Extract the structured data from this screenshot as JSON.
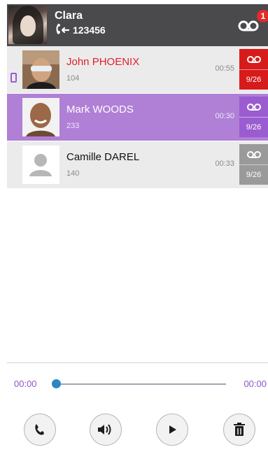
{
  "header": {
    "name": "Clara",
    "number": "123456",
    "badge_count": "1"
  },
  "calls": [
    {
      "name": "John PHOENIX",
      "ext": "104",
      "duration": "00:55",
      "date": "9/26",
      "tag_color": "#d71a1a",
      "name_color": "#e0202a",
      "selected": false
    },
    {
      "name": "Mark WOODS",
      "ext": "233",
      "duration": "00:30",
      "date": "9/26",
      "tag_color": "#9a5cd0",
      "name_color": "#ffffff",
      "selected": true
    },
    {
      "name": "Camille DAREL",
      "ext": "140",
      "duration": "00:33",
      "date": "9/26",
      "tag_color": "#9a9a9a",
      "name_color": "#111111",
      "selected": false
    }
  ],
  "player": {
    "current_time": "00:00",
    "total_time": "00:00",
    "progress": 0
  },
  "colors": {
    "accent": "#9a5cd0",
    "header_bg": "#4a4a4c",
    "selected_row": "#b07fd6"
  }
}
